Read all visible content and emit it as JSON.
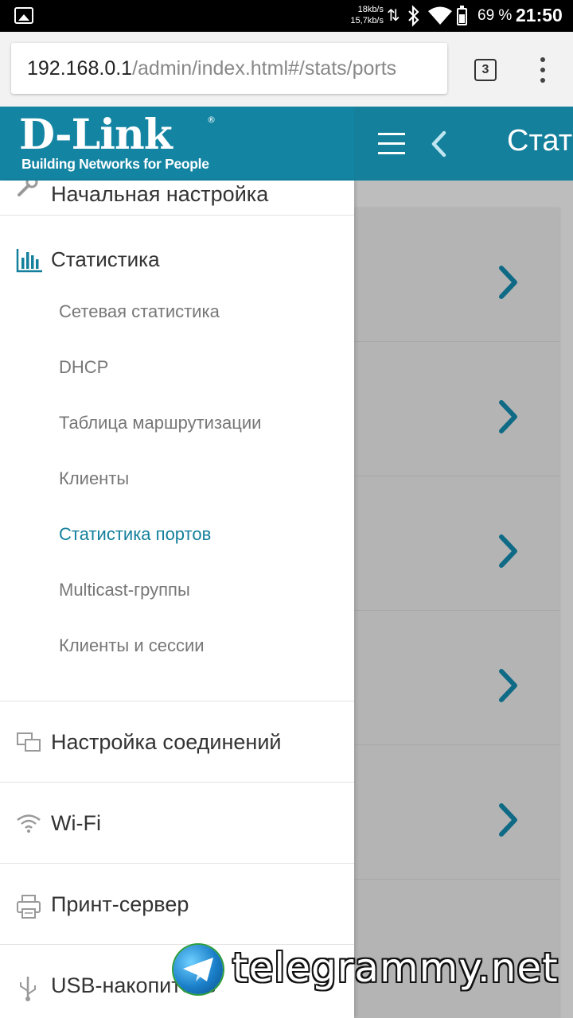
{
  "status_bar": {
    "speed_up": "18kb/s",
    "speed_down": "15,7kb/s",
    "battery_percent": "69 %",
    "time": "21:50",
    "icons": [
      "image-icon",
      "data-arrows-icon",
      "bluetooth-icon",
      "wifi-icon",
      "battery-icon"
    ]
  },
  "browser": {
    "url_host": "192.168.0.1",
    "url_path": "/admin/index.html#/stats/ports",
    "tab_count": "3",
    "menu_icon": "overflow-menu-icon"
  },
  "header": {
    "logo_text": "D-Link",
    "logo_registered": "®",
    "logo_tagline": "Building Networks for People",
    "title": "Стат",
    "brand_color": "#14809c"
  },
  "drawer": {
    "partial_item": {
      "label": "Начальная настройка",
      "icon": "wrench-icon"
    },
    "section": {
      "label": "Статистика",
      "icon": "bar-chart-icon",
      "items": [
        {
          "label": "Сетевая статистика",
          "active": false
        },
        {
          "label": "DHCP",
          "active": false
        },
        {
          "label": "Таблица маршрутизации",
          "active": false
        },
        {
          "label": "Клиенты",
          "active": false
        },
        {
          "label": "Статистика портов",
          "active": true
        },
        {
          "label": "Multicast-группы",
          "active": false
        },
        {
          "label": "Клиенты и сессии",
          "active": false
        }
      ]
    },
    "items": [
      {
        "label": "Настройка соединений",
        "icon": "connections-icon"
      },
      {
        "label": "Wi-Fi",
        "icon": "wifi-icon"
      },
      {
        "label": "Принт-сервер",
        "icon": "printer-icon"
      },
      {
        "label": "USB-накопитель",
        "icon": "usb-icon"
      }
    ]
  },
  "content": {
    "row_count_icon": "chevron-right-icon"
  },
  "watermark": {
    "text": "telegrammy.net"
  }
}
